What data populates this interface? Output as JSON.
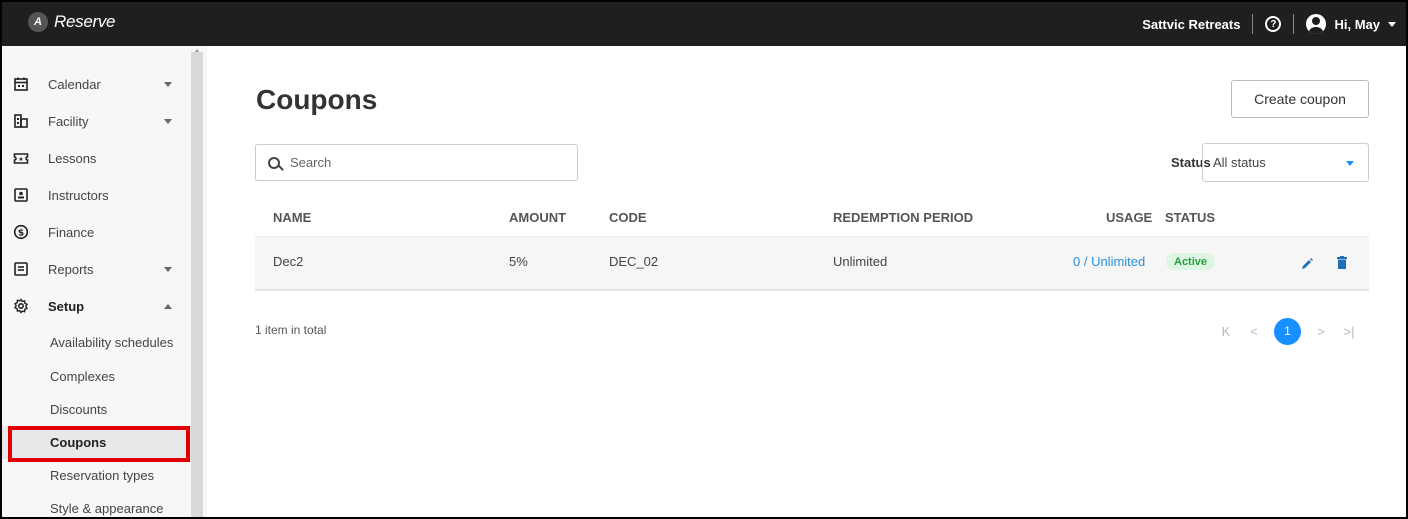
{
  "header": {
    "app_name": "Reserve",
    "logo_mark": "A",
    "org_name": "Sattvic Retreats",
    "help_glyph": "?",
    "user_greeting": "Hi, May"
  },
  "sidebar": {
    "items": [
      {
        "label": "Calendar",
        "icon": "calendar-icon"
      },
      {
        "label": "Facility",
        "icon": "building-icon"
      },
      {
        "label": "Lessons",
        "icon": "ticket-icon"
      },
      {
        "label": "Instructors",
        "icon": "id-card-icon"
      },
      {
        "label": "Finance",
        "icon": "dollar-icon"
      },
      {
        "label": "Reports",
        "icon": "report-icon"
      },
      {
        "label": "Setup",
        "icon": "gear-icon"
      }
    ],
    "setup_children": [
      {
        "label": "Availability schedules"
      },
      {
        "label": "Complexes"
      },
      {
        "label": "Discounts"
      },
      {
        "label": "Coupons"
      },
      {
        "label": "Reservation types"
      },
      {
        "label": "Style & appearance"
      }
    ],
    "active_item": "Coupons"
  },
  "main": {
    "title": "Coupons",
    "create_button": "Create coupon",
    "search_placeholder": "Search",
    "status_label": "Status",
    "status_value": "All status",
    "columns": [
      "NAME",
      "AMOUNT",
      "CODE",
      "REDEMPTION PERIOD",
      "USAGE",
      "STATUS"
    ],
    "rows": [
      {
        "name": "Dec2",
        "amount": "5%",
        "code": "DEC_02",
        "redemption_period": "Unlimited",
        "usage": "0 / Unlimited",
        "status": "Active"
      }
    ],
    "total_text": "1 item in total",
    "pagination": {
      "current_page": "1",
      "first": "K",
      "prev": "<",
      "next": ">",
      "last": ">|"
    }
  },
  "colors": {
    "topbar": "#1f1f1f",
    "accent": "#1890ff",
    "active_badge_bg": "#dff5e3",
    "active_badge_text": "#2a9d3c",
    "highlight": "#e00000"
  }
}
